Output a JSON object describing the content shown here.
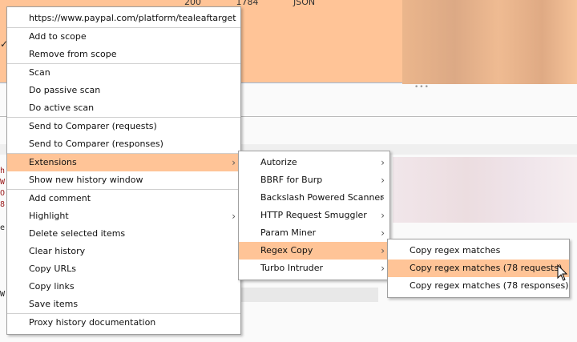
{
  "background": {
    "header_cells": "200 1784 JSON",
    "fragments": [
      "h",
      "W",
      "O",
      "8",
      "e",
      "W"
    ],
    "checkmarks": [
      "✓",
      "✓"
    ]
  },
  "context_menu": {
    "items": [
      {
        "label": "https://www.paypal.com/platform/tealeaftarget"
      },
      {
        "sep": true
      },
      {
        "label": "Add to scope"
      },
      {
        "label": "Remove from scope"
      },
      {
        "sep": true
      },
      {
        "label": "Scan"
      },
      {
        "label": "Do passive scan"
      },
      {
        "label": "Do active scan"
      },
      {
        "sep": true
      },
      {
        "label": "Send to Comparer (requests)"
      },
      {
        "label": "Send to Comparer (responses)"
      },
      {
        "sep": true
      },
      {
        "label": "Extensions",
        "submenu": true,
        "highlighted": true
      },
      {
        "label": "Show new history window"
      },
      {
        "sep": true
      },
      {
        "label": "Add comment"
      },
      {
        "label": "Highlight",
        "submenu": true
      },
      {
        "label": "Delete selected items"
      },
      {
        "label": "Clear history"
      },
      {
        "label": "Copy URLs"
      },
      {
        "label": "Copy links"
      },
      {
        "label": "Save items"
      },
      {
        "sep": true
      },
      {
        "label": "Proxy history documentation"
      }
    ]
  },
  "extensions_menu": {
    "items": [
      {
        "label": "Autorize",
        "submenu": true
      },
      {
        "label": "BBRF for Burp",
        "submenu": true
      },
      {
        "label": "Backslash Powered Scanner",
        "submenu": true
      },
      {
        "label": "HTTP Request Smuggler",
        "submenu": true
      },
      {
        "label": "Param Miner",
        "submenu": true
      },
      {
        "label": "Regex Copy",
        "submenu": true,
        "highlighted": true
      },
      {
        "label": "Turbo Intruder",
        "submenu": true
      }
    ]
  },
  "regex_copy_menu": {
    "items": [
      {
        "label": "Copy regex matches"
      },
      {
        "label": "Copy regex matches (78 requests)",
        "highlighted": true
      },
      {
        "label": "Copy regex matches (78 responses)"
      }
    ]
  },
  "colors": {
    "highlight": "#ffc497"
  }
}
